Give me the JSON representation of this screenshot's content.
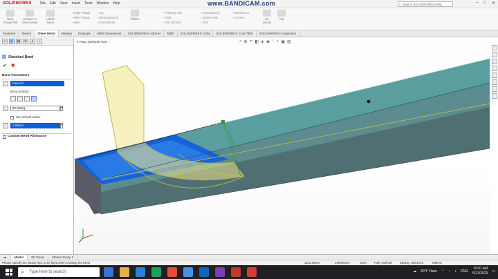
{
  "app": {
    "logo": "SOLIDWORKS",
    "menu": [
      "File",
      "Edit",
      "View",
      "Insert",
      "Tools",
      "Window",
      "Help"
    ],
    "watermark": "www.BANDICAM.com",
    "search_placeholder": "Search SOLIDWORKS Help"
  },
  "ribbon": {
    "groups": [
      "Base Flange/Tab",
      "Convert to Sheet Metal",
      "Lofted-Bend",
      "Flatten",
      "No Bends",
      "Rip"
    ],
    "col1": [
      "Edge Flange",
      "Miter Flange",
      "Hem"
    ],
    "col2": [
      "Jog",
      "Sketched Bend",
      "Cross-Break"
    ],
    "col3": [
      "Forming Tool",
      "Vent",
      "Tab and Slot"
    ],
    "col4": [
      "Extruded Cut",
      "Simple Hole",
      "Vent"
    ],
    "col5": [
      "Normal Cut",
      "Corners"
    ]
  },
  "tabs": [
    "Features",
    "Sketch",
    "Sheet Metal",
    "Markup",
    "Evaluate",
    "MBD Dimensions",
    "SOLIDWORKS Add-Ins",
    "MBD",
    "SOLIDWORKS CAM",
    "SOLIDWORKS CAM TBM",
    "SOLIDWORKS Inspection"
  ],
  "active_tab": "Sheet Metal",
  "panel": {
    "title": "Sketched Bend",
    "section1": "Bend Parameters",
    "face_value": "Face<1>",
    "bend_position": "Bend position:",
    "bend_radius_label": "90.00deg",
    "use_default_radius": "Use default radius",
    "radius_value": "1.00mm",
    "section2": "Custom Bend Allowance"
  },
  "viewport": {
    "breadcrumb": "Part1 (Default<<De..."
  },
  "bottom_tabs": [
    "Model",
    "3D Views",
    "Motion Study 1"
  ],
  "active_bottom_tab": "Model",
  "status": {
    "message": "Please specify the planar face to be fixed when creating the bend",
    "v1": "1183.65mm",
    "v2": "100000mm",
    "v3": "0mm",
    "v4": "Fully Defined",
    "v5": "Editing: Sketch16",
    "v6": "MMGS"
  },
  "taskbar": {
    "search_placeholder": "Type here to search",
    "weather": "80°F Haze",
    "lang": "ENG",
    "time": "10:01 AM",
    "date": "5/21/2023",
    "app_colors": [
      "#3c6fd8",
      "#e3b341",
      "#2b7fd6",
      "#1aa260",
      "#e84c3d",
      "#4a90e2",
      "#0d67b6",
      "#7b3fb8",
      "#c0392b",
      "#d53d3d"
    ]
  }
}
